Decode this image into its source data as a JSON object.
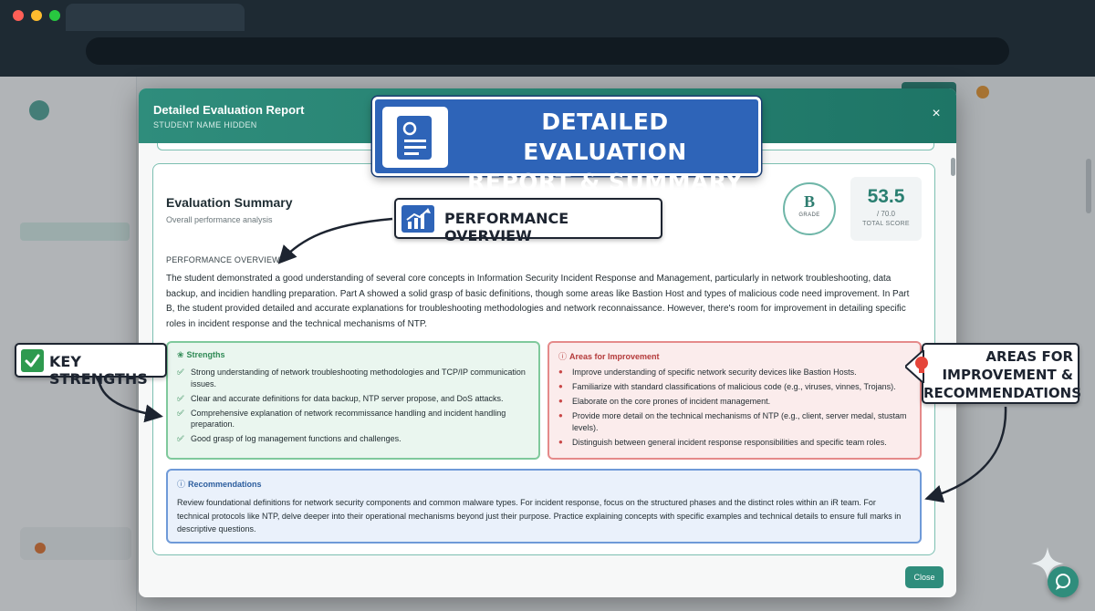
{
  "modal": {
    "title": "Detailed Evaluation Report",
    "subtitle": "STUDENT NAME HIDDEN",
    "close_icon": "×",
    "footer_button": "Close"
  },
  "summary": {
    "title": "Evaluation Summary",
    "subtitle": "Overall performance analysis",
    "grade_letter": "B",
    "grade_label": "GRADE",
    "score": "53.5",
    "score_max": "/ 70.0",
    "score_label": "TOTAL SCORE",
    "performance_label": "PERFORMANCE OVERVIEW",
    "performance_text": "The student demonstrated a good understanding of several core concepts in Information Security Incident Response and Management, particularly in network troubleshooting, data backup, and incidien handling preparation. Part A showed a solid grasp of basic definitions, though some areas like Bastion Host and types of malicious code need improvement. In Part B, the student provided detailed and accurate explanations for troubleshooting methodologies and network reconnaissance. However, there's room for improvement in detailing specific roles in incident response and the technical mechanisms of NTP."
  },
  "strengths": {
    "title": "Strengths",
    "icon": "ribbon-icon",
    "items": [
      "Strong understanding of network troubleshooting methodologies and TCP/IP communication issues.",
      "Clear and accurate definitions for data backup, NTP server propose, and DoS attacks.",
      "Comprehensive explanation of network recommissance handling and incident handling preparation.",
      "Good grasp of log management functions and challenges."
    ]
  },
  "improvements": {
    "title": "Areas for Improvement",
    "icon": "info-icon",
    "items": [
      "Improve understanding of specific network security devices like Bastion Hosts.",
      "Familiarize with standard classifications of malicious code (e.g., viruses, vinnes, Trojans).",
      "Elaborate on the core prones of incident management.",
      "Provide more detail on the technical mechanisms of NTP (e.g., client, server medal, stustam levels).",
      "Distinguish between general incident response responsibilities and specific team roles."
    ]
  },
  "recommendations": {
    "title": "Recommendations",
    "text": "Review foundational definitions for network security components and common malware types. For incident response, focus on the structured phases and the distinct roles within an iR team. For technical protocols like NTP, delve deeper into their operational mechanisms beyond just their purpose. Practice explaining concepts with specific examples and technical details to ensure full marks in descriptive questions."
  },
  "callouts": {
    "main_line1": "DETAILED EVALUATION",
    "main_line2": "REPORT & SUMMARY",
    "performance": "PERFORMANCE OVERVIEW",
    "strengths": "KEY STRENGTHS",
    "areas_line1": "AREAS FOR",
    "areas_line2": "IMPROVEMENT &",
    "areas_line3": "RECOMMENDATIONS"
  },
  "colors": {
    "header_teal": "#2f8d7c",
    "strengths_green": "#7fc99c",
    "improvement_red": "#e58a8a",
    "recommendation_blue": "#6f9ad8",
    "callout_blue": "#2e64b8"
  }
}
